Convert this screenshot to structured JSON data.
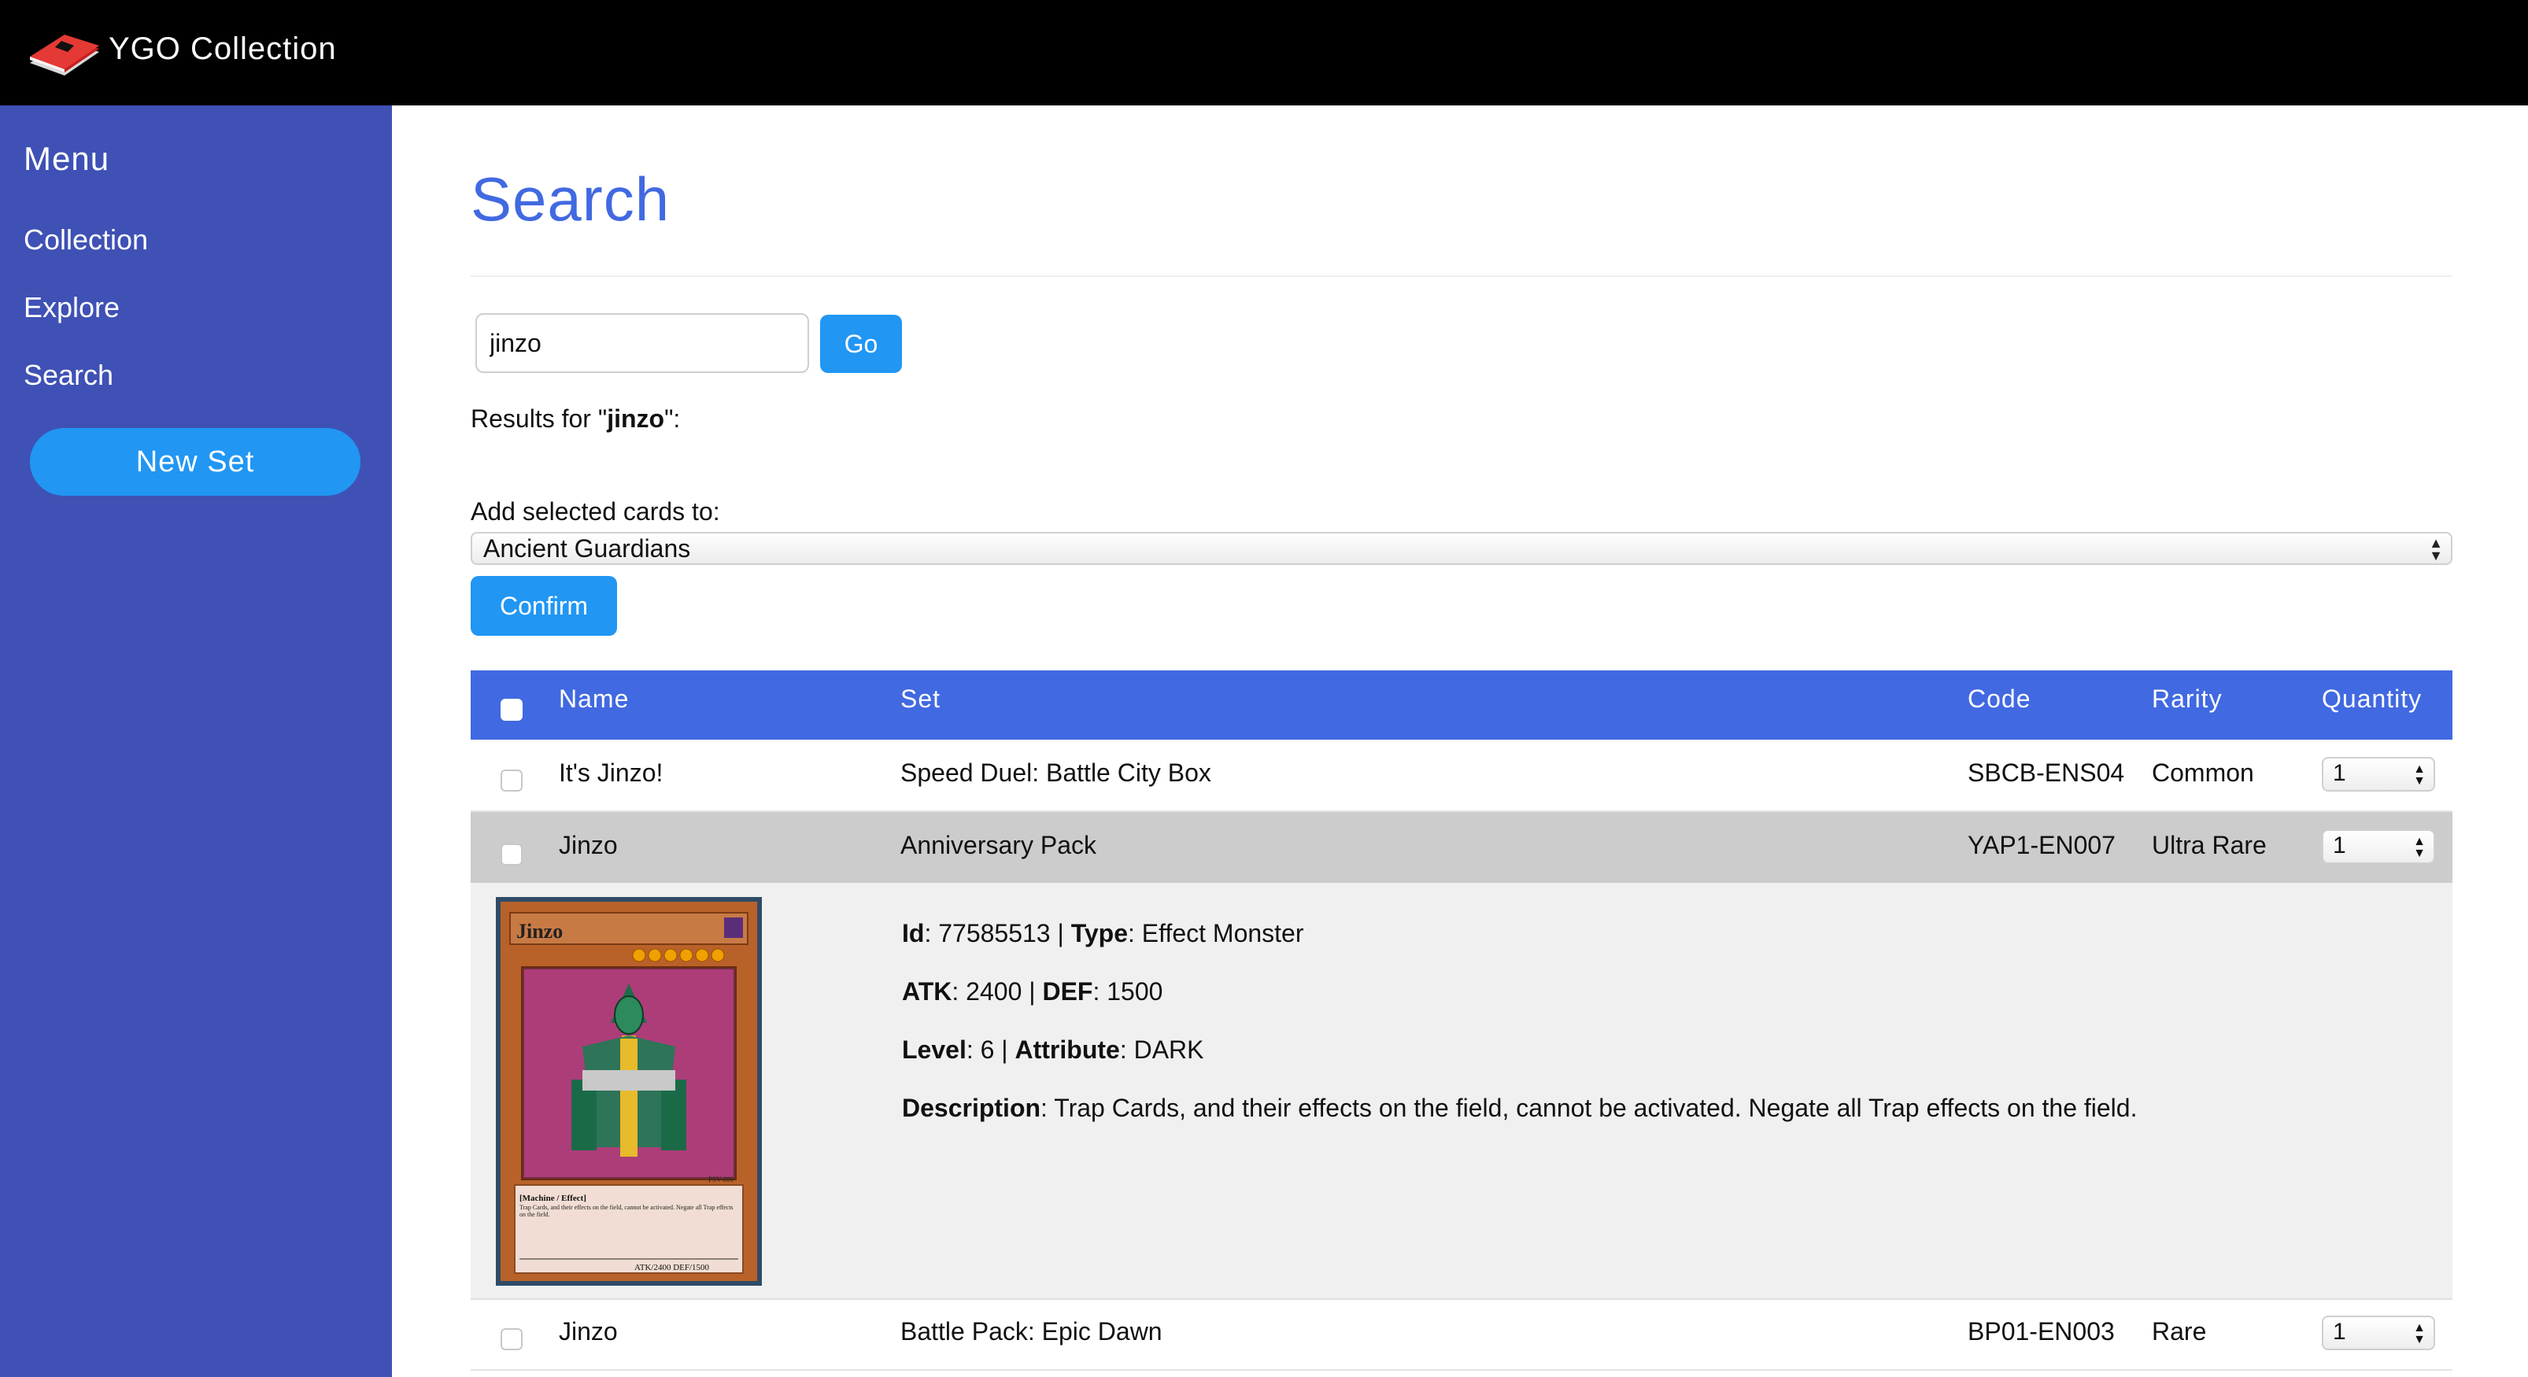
{
  "header": {
    "app_title": "YGO Collection",
    "logo_icon": "card-stack-logo"
  },
  "sidebar": {
    "heading": "Menu",
    "items": [
      {
        "label": "Collection"
      },
      {
        "label": "Explore"
      },
      {
        "label": "Search"
      }
    ],
    "new_set_label": "New Set"
  },
  "main": {
    "title": "Search",
    "search": {
      "value": "jinzo",
      "go_label": "Go"
    },
    "results_prefix": "Results for \"",
    "results_query": "jinzo",
    "results_suffix": "\":",
    "add_label": "Add selected cards to:",
    "selected_set": "Ancient Guardians",
    "confirm_label": "Confirm",
    "table": {
      "headers": {
        "name": "Name",
        "set": "Set",
        "code": "Code",
        "rarity": "Rarity",
        "quantity": "Quantity"
      },
      "rows": [
        {
          "name": "It's Jinzo!",
          "set": "Speed Duel: Battle City Box",
          "code": "SBCB-ENS04",
          "rarity": "Common",
          "quantity": "1"
        },
        {
          "name": "Jinzo",
          "set": "Anniversary Pack",
          "code": "YAP1-EN007",
          "rarity": "Ultra Rare",
          "quantity": "1"
        },
        {
          "name": "Jinzo",
          "set": "Battle Pack: Epic Dawn",
          "code": "BP01-EN003",
          "rarity": "Rare",
          "quantity": "1"
        }
      ],
      "detail": {
        "id_label": "Id",
        "id": "77585513",
        "type_label": "Type",
        "type": "Effect Monster",
        "atk_label": "ATK",
        "atk": "2400",
        "def_label": "DEF",
        "def": "1500",
        "level_label": "Level",
        "level": "6",
        "attribute_label": "Attribute",
        "attribute": "DARK",
        "description_label": "Description",
        "description": "Trap Cards, and their effects on the field, cannot be activated. Negate all Trap effects on the field.",
        "card": {
          "name": "Jinzo",
          "type_line": "[Machine / Effect]",
          "card_text": "Trap Cards, and their effects on the field, cannot be activated. Negate all Trap effects on the field.",
          "stats": "ATK/2400  DEF/1500",
          "set_code": "PSV-000"
        }
      }
    }
  },
  "colors": {
    "accent": "#4169e1",
    "button": "#2196f3",
    "sidebar": "#3f51b5",
    "topbar": "#000000"
  }
}
